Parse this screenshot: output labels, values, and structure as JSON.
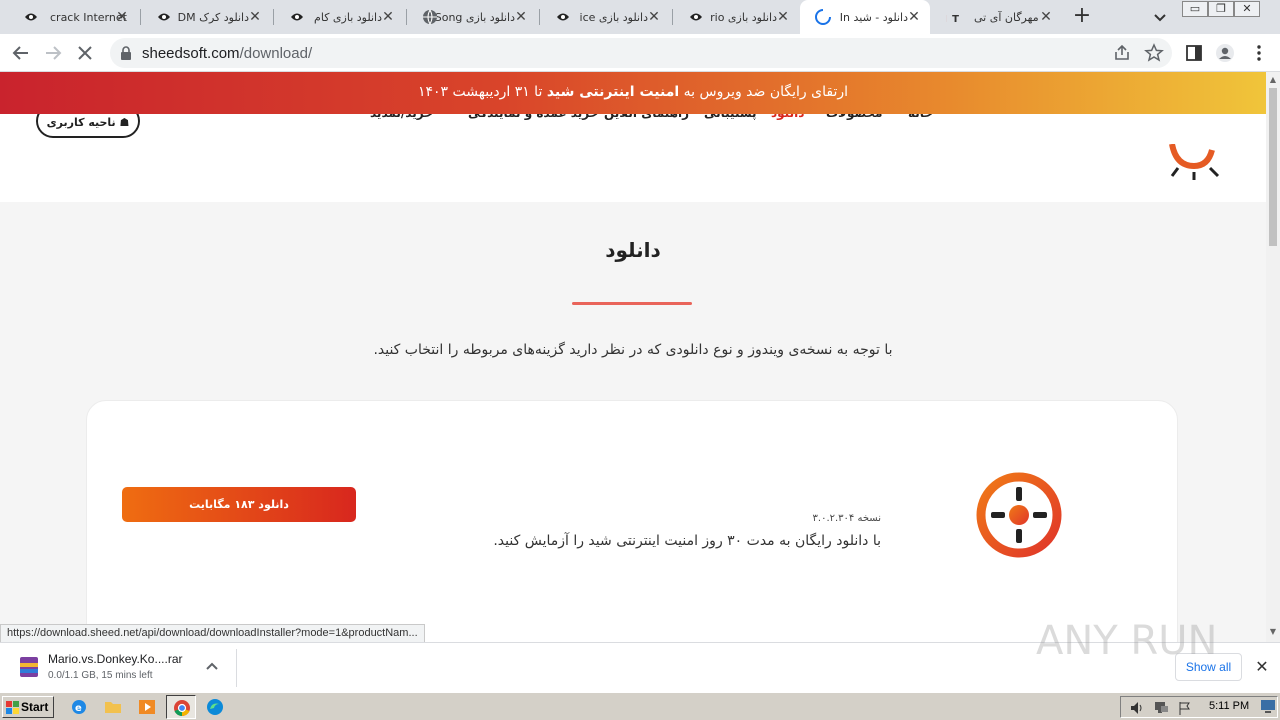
{
  "browser": {
    "tabs": [
      {
        "title": "crack Internet",
        "favicon": "site-logo-icon"
      },
      {
        "title": "دانلود کرک DM",
        "favicon": "site-logo-icon"
      },
      {
        "title": "دانلود بازی کام",
        "favicon": "site-logo-icon"
      },
      {
        "title": "دانلود بازی Song",
        "favicon": "globe-icon"
      },
      {
        "title": "دانلود بازی ice",
        "favicon": "site-logo-icon"
      },
      {
        "title": "دانلود بازی rio",
        "favicon": "site-logo-icon"
      },
      {
        "title": "دانلود - شید In",
        "favicon": "loading-spinner-icon",
        "active": true
      },
      {
        "title": "مهرگان آی تی",
        "favicon": "mit-logo-icon"
      }
    ],
    "url_host": "sheedsoft.com",
    "url_path": "/download/"
  },
  "page": {
    "promo_prefix": "ارتقای رایگان ضد ویروس به",
    "promo_bold": "امنیت اینترنتی شید",
    "promo_suffix": "تا ۳۱ اردیبهشت ۱۴۰۳",
    "nav": [
      "خانه",
      "محصولات",
      "دانلود",
      "پشتیبانی",
      "راهنمای آنلاین",
      "خرید عمده و نمایندگی",
      "خرید/تمدید"
    ],
    "nav_active_color": "#d8271e",
    "account_label": "ناحیه کاربری",
    "title": "دانلود",
    "description": "با توجه به نسخه‌ی ویندوز و نوع دانلودی که در نظر دارید گزینه‌های مربوطه را انتخاب کنید.",
    "card": {
      "version": "نسخه ۳.۰.۲.۳۰۴",
      "trial_text": "با دانلود رایگان به مدت ۳۰ روز امنیت اینترنتی شید را آزمایش کنید.",
      "download_label": "دانلود ۱۸۳ مگابایت"
    },
    "status_url": "https://download.sheed.net/api/download/downloadInstaller?mode=1&productNam..."
  },
  "downloads": {
    "file_name": "Mario.vs.Donkey.Ko....rar",
    "file_status": "0.0/1.1 GB, 15 mins left",
    "show_all_label": "Show all"
  },
  "taskbar": {
    "start_label": "Start",
    "clock": "5:11 PM"
  },
  "watermark_text": "ANY RUN"
}
